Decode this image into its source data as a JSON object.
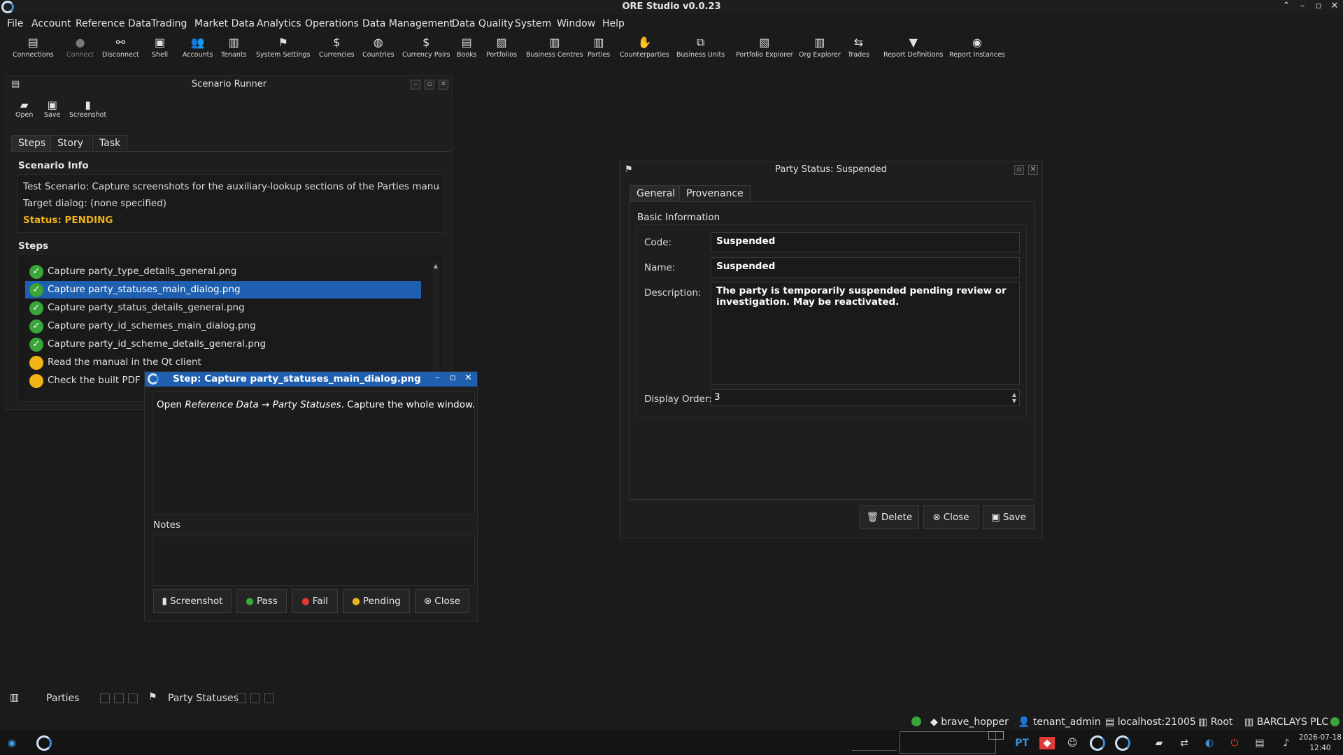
{
  "window": {
    "title": "ORE Studio v0.0.23"
  },
  "menu": [
    "File",
    "Account",
    "Reference Data",
    "Trading",
    "Market Data",
    "Analytics",
    "Operations",
    "Data Management",
    "Data Quality",
    "System",
    "Window",
    "Help"
  ],
  "toolbar": [
    {
      "label": "Connections",
      "icon": "server-icon",
      "enabled": true
    },
    {
      "label": "Connect",
      "icon": "connect-icon",
      "enabled": false
    },
    {
      "label": "Disconnect",
      "icon": "disconnect-icon",
      "enabled": true
    },
    {
      "label": "Shell",
      "icon": "terminal-icon",
      "enabled": true
    },
    {
      "label": "Accounts",
      "icon": "users-icon",
      "enabled": true
    },
    {
      "label": "Tenants",
      "icon": "building-icon",
      "enabled": true
    },
    {
      "label": "System Settings",
      "icon": "flag-icon",
      "enabled": true
    },
    {
      "label": "Currencies",
      "icon": "currency-icon",
      "enabled": true
    },
    {
      "label": "Countries",
      "icon": "globe-icon",
      "enabled": true
    },
    {
      "label": "Currency Pairs",
      "icon": "currency-icon",
      "enabled": true
    },
    {
      "label": "Books",
      "icon": "book-icon",
      "enabled": true
    },
    {
      "label": "Portfolios",
      "icon": "briefcase-icon",
      "enabled": true
    },
    {
      "label": "Business Centres",
      "icon": "building-icon",
      "enabled": true
    },
    {
      "label": "Parties",
      "icon": "building-icon",
      "enabled": true
    },
    {
      "label": "Counterparties",
      "icon": "handshake-icon",
      "enabled": true
    },
    {
      "label": "Business Units",
      "icon": "units-icon",
      "enabled": true
    },
    {
      "label": "Portfolio Explorer",
      "icon": "briefcase-icon",
      "enabled": true
    },
    {
      "label": "Org Explorer",
      "icon": "building-icon",
      "enabled": true
    },
    {
      "label": "Trades",
      "icon": "arrows-icon",
      "enabled": true
    },
    {
      "label": "Report Definitions",
      "icon": "report-icon",
      "enabled": true
    },
    {
      "label": "Report Instances",
      "icon": "report-instance-icon",
      "enabled": true
    }
  ],
  "scenario": {
    "title": "Scenario Runner",
    "actions": [
      "Open",
      "Save",
      "Screenshot"
    ],
    "tabs": [
      "Steps",
      "Story",
      "Task"
    ],
    "info_title": "Scenario Info",
    "description": "Test Scenario: Capture screenshots for the auxiliary-lookup sections of the Parties manual chapte",
    "target": "Target dialog: (none specified)",
    "status": "Status: PENDING",
    "status_color": "#f0b418",
    "steps_title": "Steps",
    "steps": [
      {
        "label": "Capture party_type_details_general.png",
        "state": "pass"
      },
      {
        "label": "Capture party_statuses_main_dialog.png",
        "state": "pass",
        "selected": true
      },
      {
        "label": "Capture party_status_details_general.png",
        "state": "pass"
      },
      {
        "label": "Capture party_id_schemes_main_dialog.png",
        "state": "pass"
      },
      {
        "label": "Capture party_id_scheme_details_general.png",
        "state": "pass"
      },
      {
        "label": "Read the manual in the Qt client",
        "state": "pending"
      },
      {
        "label": "Check the built PDF",
        "state": "pending"
      }
    ]
  },
  "step_dialog": {
    "title": "Step: Capture party_statuses_main_dialog.png",
    "instr_prefix": "Open ",
    "instr_ref": "Reference Data",
    "instr_arrow": " → ",
    "instr_target": "Party Statuses",
    "instr_suffix": ". Capture the whole window.",
    "notes_label": "Notes",
    "buttons": [
      "Screenshot",
      "Pass",
      "Fail",
      "Pending",
      "Close"
    ]
  },
  "party_status": {
    "title": "Party Status: Suspended",
    "tabs": [
      "General",
      "Provenance"
    ],
    "section": "Basic Information",
    "code_label": "Code:",
    "code": "Suspended",
    "name_label": "Name:",
    "name": "Suspended",
    "desc_label": "Description:",
    "description": "The party is temporarily suspended pending review or investigation. May be reactivated.",
    "order_label": "Display Order:",
    "order": "3",
    "buttons": [
      "Delete",
      "Close",
      "Save"
    ]
  },
  "docked": [
    "Parties",
    "Party Statuses"
  ],
  "status_bar": {
    "user": "brave_hopper",
    "tenant": "tenant_admin",
    "server": "localhost:21005",
    "scope": "Root",
    "party": "BARCLAYS PLC",
    "connected_color": "#3aa63a"
  },
  "taskbar": {
    "lang": "PT",
    "date": "2026-07-18",
    "time": "12:40"
  }
}
